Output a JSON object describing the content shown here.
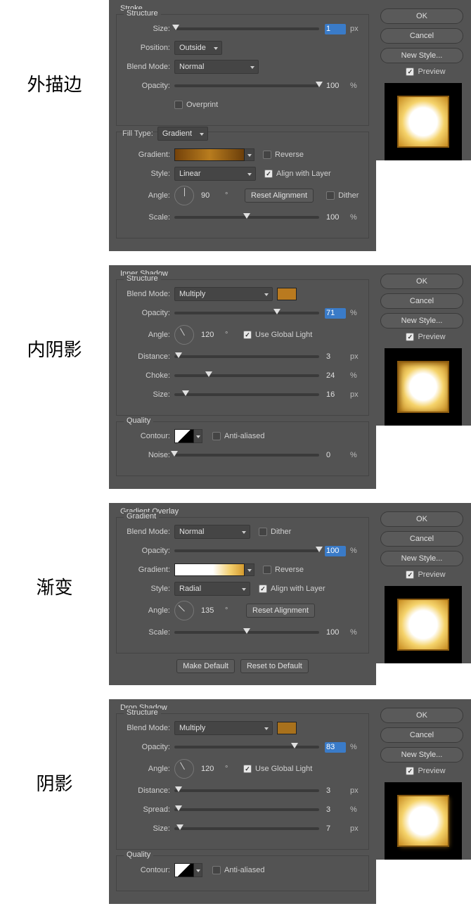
{
  "common": {
    "ok": "OK",
    "cancel": "Cancel",
    "new_style": "New Style...",
    "preview": "Preview",
    "blend_mode": "Blend Mode:",
    "opacity": "Opacity:",
    "angle": "Angle:",
    "size": "Size:",
    "scale": "Scale:",
    "style": "Style:",
    "gradient": "Gradient:",
    "contour": "Contour:",
    "noise": "Noise:",
    "distance": "Distance:",
    "px": "px",
    "pct": "%",
    "deg": "°",
    "reverse": "Reverse",
    "align": "Align with Layer",
    "reset_align": "Reset Alignment",
    "dither": "Dither",
    "global_light": "Use Global Light",
    "anti_aliased": "Anti-aliased",
    "make_default": "Make Default",
    "reset_default": "Reset to Default",
    "structure": "Structure",
    "quality": "Quality"
  },
  "stroke": {
    "cn": "外描边",
    "title": "Stroke",
    "size": "1",
    "position_label": "Position:",
    "position": "Outside",
    "blend": "Normal",
    "opacity": "100",
    "overprint": "Overprint",
    "fill_type_label": "Fill Type:",
    "fill_type": "Gradient",
    "style": "Linear",
    "angle": "90",
    "scale": "100"
  },
  "inner_shadow": {
    "cn": "内阴影",
    "title": "Inner Shadow",
    "blend": "Multiply",
    "color": "#b97a1f",
    "opacity": "71",
    "angle": "120",
    "distance": "3",
    "choke_label": "Choke:",
    "choke": "24",
    "size": "16",
    "noise": "0"
  },
  "gradient_overlay": {
    "cn": "渐变",
    "title": "Gradient Overlay",
    "section": "Gradient",
    "blend": "Normal",
    "opacity": "100",
    "style": "Radial",
    "angle": "135",
    "scale": "100"
  },
  "drop_shadow": {
    "cn": "阴影",
    "title": "Drop Shadow",
    "blend": "Multiply",
    "color": "#a8711c",
    "opacity": "83",
    "angle": "120",
    "distance": "3",
    "spread_label": "Spread:",
    "spread": "3",
    "size": "7"
  }
}
